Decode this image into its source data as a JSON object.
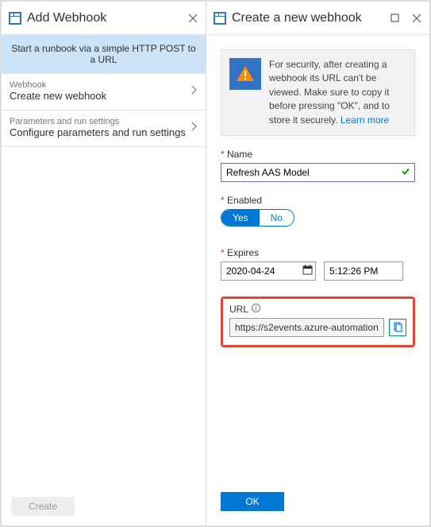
{
  "left": {
    "title": "Add Webhook",
    "banner": "Start a runbook via a simple HTTP POST to a URL",
    "item1_sub": "Webhook",
    "item1_main": "Create new webhook",
    "item2_sub": "Parameters and run settings",
    "item2_main": "Configure parameters and run settings",
    "create": "Create"
  },
  "right": {
    "title": "Create a new webhook",
    "info_text": "For security, after creating a webhook its URL can't be viewed. Make sure to copy it before pressing \"OK\", and to store it securely. ",
    "learn_more": "Learn more",
    "name_label": "Name",
    "name_value": "Refresh AAS Model",
    "enabled_label": "Enabled",
    "yes": "Yes",
    "no": "No",
    "expires_label": "Expires",
    "date_value": "2020-04-24",
    "time_value": "5:12:26 PM",
    "url_label": "URL",
    "url_value": "https://s2events.azure-automation.net/...",
    "ok": "OK"
  }
}
